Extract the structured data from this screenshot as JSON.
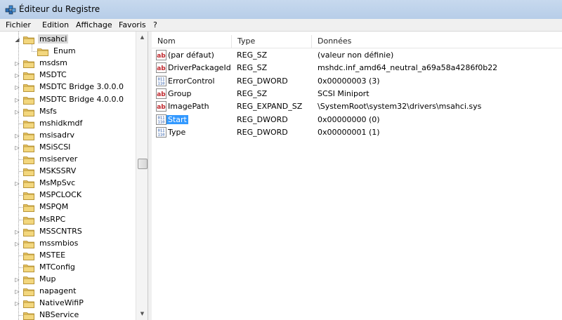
{
  "window": {
    "title": "Éditeur du Registre"
  },
  "menu": [
    "Fichier",
    "Edition",
    "Affichage",
    "Favoris",
    "?"
  ],
  "tree": {
    "items": [
      {
        "label": "msahci",
        "expander": "◢",
        "selected": true,
        "indent": 0
      },
      {
        "label": "Enum",
        "expander": "",
        "selected": false,
        "indent": 1
      },
      {
        "label": "msdsm",
        "expander": "▷",
        "selected": false,
        "indent": 0
      },
      {
        "label": "MSDTC",
        "expander": "▷",
        "selected": false,
        "indent": 0
      },
      {
        "label": "MSDTC Bridge 3.0.0.0",
        "expander": "▷",
        "selected": false,
        "indent": 0
      },
      {
        "label": "MSDTC Bridge 4.0.0.0",
        "expander": "▷",
        "selected": false,
        "indent": 0
      },
      {
        "label": "Msfs",
        "expander": "▷",
        "selected": false,
        "indent": 0
      },
      {
        "label": "mshidkmdf",
        "expander": "",
        "selected": false,
        "indent": 0
      },
      {
        "label": "msisadrv",
        "expander": "▷",
        "selected": false,
        "indent": 0
      },
      {
        "label": "MSiSCSI",
        "expander": "▷",
        "selected": false,
        "indent": 0
      },
      {
        "label": "msiserver",
        "expander": "",
        "selected": false,
        "indent": 0
      },
      {
        "label": "MSKSSRV",
        "expander": "",
        "selected": false,
        "indent": 0
      },
      {
        "label": "MsMpSvc",
        "expander": "▷",
        "selected": false,
        "indent": 0
      },
      {
        "label": "MSPCLOCK",
        "expander": "",
        "selected": false,
        "indent": 0
      },
      {
        "label": "MSPQM",
        "expander": "",
        "selected": false,
        "indent": 0
      },
      {
        "label": "MsRPC",
        "expander": "",
        "selected": false,
        "indent": 0
      },
      {
        "label": "MSSCNTRS",
        "expander": "▷",
        "selected": false,
        "indent": 0
      },
      {
        "label": "mssmbios",
        "expander": "▷",
        "selected": false,
        "indent": 0
      },
      {
        "label": "MSTEE",
        "expander": "",
        "selected": false,
        "indent": 0
      },
      {
        "label": "MTConfig",
        "expander": "",
        "selected": false,
        "indent": 0
      },
      {
        "label": "Mup",
        "expander": "▷",
        "selected": false,
        "indent": 0
      },
      {
        "label": "napagent",
        "expander": "▷",
        "selected": false,
        "indent": 0
      },
      {
        "label": "NativeWifiP",
        "expander": "▷",
        "selected": false,
        "indent": 0
      },
      {
        "label": "NBService",
        "expander": "",
        "selected": false,
        "indent": 0
      }
    ]
  },
  "values_pane": {
    "headers": {
      "name": "Nom",
      "type": "Type",
      "data": "Données"
    },
    "rows": [
      {
        "icon": "string-value-icon",
        "name": "(par défaut)",
        "type": "REG_SZ",
        "data": "(valeur non définie)",
        "selected": false
      },
      {
        "icon": "string-value-icon",
        "name": "DriverPackageId",
        "type": "REG_SZ",
        "data": "mshdc.inf_amd64_neutral_a69a58a4286f0b22",
        "selected": false
      },
      {
        "icon": "binary-value-icon",
        "name": "ErrorControl",
        "type": "REG_DWORD",
        "data": "0x00000003 (3)",
        "selected": false
      },
      {
        "icon": "string-value-icon",
        "name": "Group",
        "type": "REG_SZ",
        "data": "SCSI Miniport",
        "selected": false
      },
      {
        "icon": "string-value-icon",
        "name": "ImagePath",
        "type": "REG_EXPAND_SZ",
        "data": "\\SystemRoot\\system32\\drivers\\msahci.sys",
        "selected": false
      },
      {
        "icon": "binary-value-icon",
        "name": "Start",
        "type": "REG_DWORD",
        "data": "0x00000000 (0)",
        "selected": true
      },
      {
        "icon": "binary-value-icon",
        "name": "Type",
        "type": "REG_DWORD",
        "data": "0x00000001 (1)",
        "selected": false
      }
    ]
  },
  "icons": {
    "string_value": "ab",
    "binary_value": "011 110"
  },
  "colors": {
    "selection": "#3399ff",
    "folder": "#e8c464"
  }
}
